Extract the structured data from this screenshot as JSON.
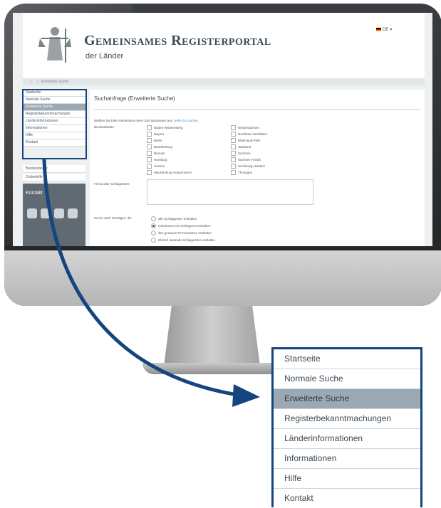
{
  "portal": {
    "title": "Gemeinsames Registerportal",
    "subtitle": "der Länder",
    "language": "DE"
  },
  "breadcrumb": "Erweiterte Suche",
  "menu": [
    {
      "label": "Startseite",
      "active": false
    },
    {
      "label": "Normale Suche",
      "active": false
    },
    {
      "label": "Erweiterte Suche",
      "active": true
    },
    {
      "label": "Registerbekanntmachungen",
      "active": false
    },
    {
      "label": "Länderinformationen",
      "active": false
    },
    {
      "label": "Informationen",
      "active": false
    },
    {
      "label": "Hilfe",
      "active": false
    },
    {
      "label": "Kontakt",
      "active": false
    }
  ],
  "side_lower": {
    "item1": "Bundesländer",
    "item2": "Onlinehilfe",
    "kontakt": "Kontakt"
  },
  "main": {
    "title": "Suchanfrage (Erweiterte Suche)",
    "intro": "Wählen Sie bitte mindestens einen Suchparameter aus.",
    "intro_link": "(Hilfe zur Suche)",
    "bundeslaender_label": "Bundesländer:",
    "states_left": [
      "Baden-Württemberg",
      "Bayern",
      "Berlin",
      "Brandenburg",
      "Bremen",
      "Hamburg",
      "Hessen",
      "Mecklenburg-Vorpommern"
    ],
    "states_right": [
      "Niedersachsen",
      "Nordrhein-Westfalen",
      "Rheinland-Pfalz",
      "Saarland",
      "Sachsen",
      "Sachsen-Anhalt",
      "Schleswig-Holstein",
      "Thüringen"
    ],
    "firma_label": "Firma oder Schlagwörter:",
    "suche_label": "Suche nach Einträgen, die",
    "options": [
      {
        "label": "alle Schlagwörter enthalten",
        "checked": false
      },
      {
        "label": "mindestens ein Schlagwort enthalten",
        "checked": true
      },
      {
        "label": "den genauen Firmennamen enthalten",
        "checked": false
      },
      {
        "label": "ähnlich lautende Schlagwörter enthalten",
        "checked": false
      }
    ]
  },
  "colors": {
    "highlight_border": "#15457e",
    "active_menu": "#9aa9b3",
    "arrow": "#15457e"
  }
}
